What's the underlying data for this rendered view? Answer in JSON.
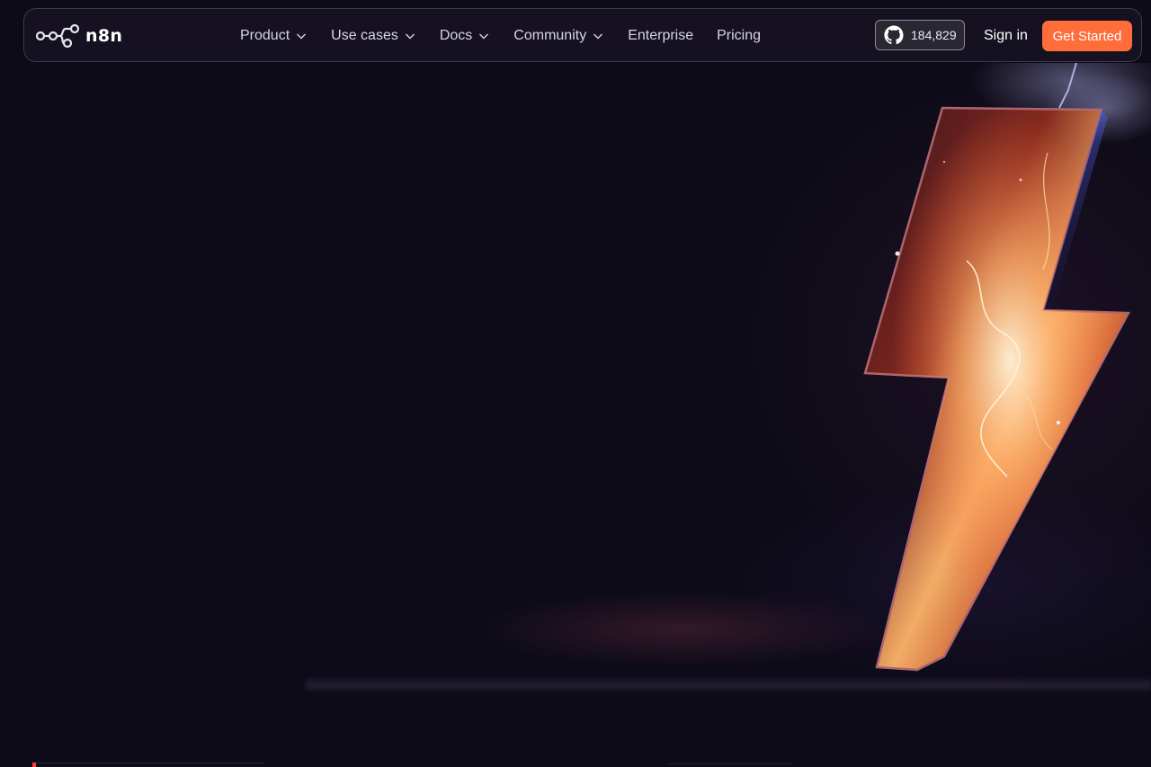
{
  "brand": {
    "name": "n8n",
    "accent_color": "#ff6d3a",
    "background_color": "#0e0b18"
  },
  "nav": {
    "items": [
      {
        "label": "Product",
        "has_dropdown": true
      },
      {
        "label": "Use cases",
        "has_dropdown": true
      },
      {
        "label": "Docs",
        "has_dropdown": true
      },
      {
        "label": "Community",
        "has_dropdown": true
      },
      {
        "label": "Enterprise",
        "has_dropdown": false
      },
      {
        "label": "Pricing",
        "has_dropdown": false
      }
    ],
    "github_stars": "184,829",
    "github_icon": "github-icon",
    "sign_in_label": "Sign in",
    "cta_label": "Get Started"
  },
  "hero": {
    "art": "lightning-bolt-illustration"
  }
}
